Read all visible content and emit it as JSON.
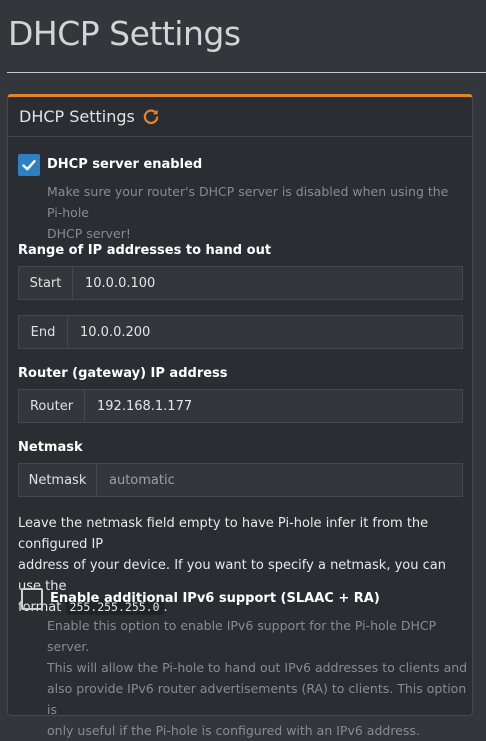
{
  "page": {
    "title": "DHCP Settings"
  },
  "card": {
    "title": "DHCP Settings"
  },
  "dhcp_enabled": {
    "checked": true,
    "label": "DHCP server enabled",
    "help_line1": "Make sure your router's DHCP server is disabled when using the Pi-hole",
    "help_line2": "DHCP server!"
  },
  "range": {
    "label": "Range of IP addresses to hand out",
    "start_label": "Start",
    "start_value": "10.0.0.100",
    "end_label": "End",
    "end_value": "10.0.0.200"
  },
  "router": {
    "label": "Router (gateway) IP address",
    "addon": "Router",
    "value": "192.168.1.177"
  },
  "netmask": {
    "label": "Netmask",
    "addon": "Netmask",
    "placeholder": "automatic",
    "note_line1": "Leave the netmask field empty to have Pi-hole infer it from the configured IP",
    "note_line2": "address of your device. If you want to specify a netmask, you can use the",
    "note_prefix": "format",
    "note_code": "255.255.255.0",
    "note_suffix": "."
  },
  "ipv6": {
    "checked": false,
    "label": "Enable additional IPv6 support (SLAAC + RA)",
    "help_line1": "Enable this option to enable IPv6 support for the Pi-hole DHCP server.",
    "help_line2": "This will allow the Pi-hole to hand out IPv6 addresses to clients and",
    "help_line3": "also provide IPv6 router advertisements (RA) to clients. This option is",
    "help_line4": "only useful if the Pi-hole is configured with an IPv6 address."
  },
  "colors": {
    "accent": "#e5852b",
    "checkbox": "#2f80c0",
    "background": "#33363b",
    "card": "#2a2e32"
  },
  "icons": {
    "refresh": "refresh-icon",
    "check": "checkmark-icon"
  }
}
